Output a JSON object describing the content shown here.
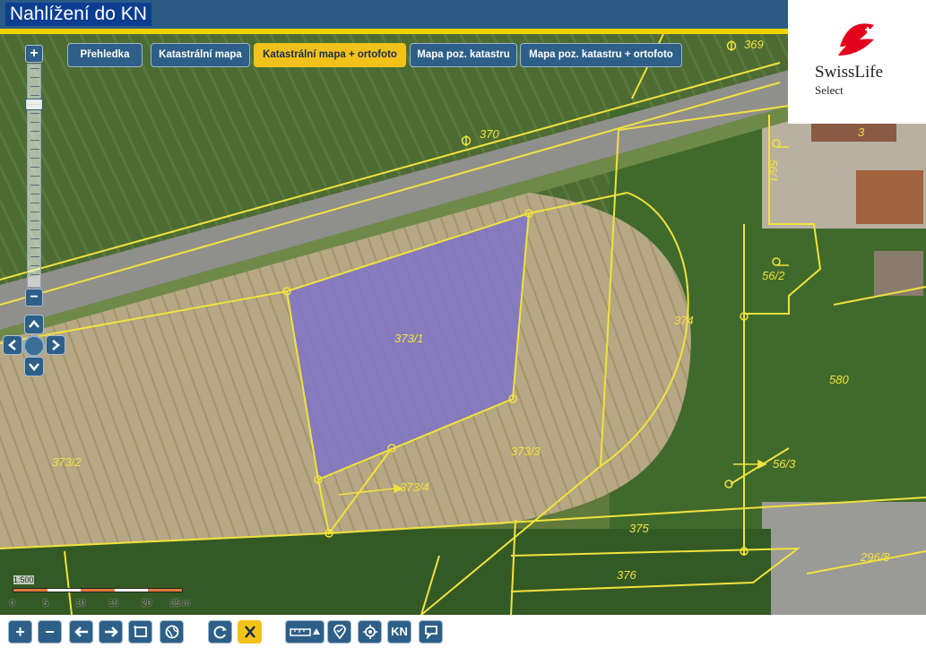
{
  "header": {
    "title": "Nahlížení do KN"
  },
  "brand": {
    "name": "SwissLife",
    "sub": "Select",
    "accent": "#e3001b"
  },
  "layer_tabs": [
    {
      "label": "Přehledka",
      "active": false
    },
    {
      "label": "Katastrální mapa",
      "active": false
    },
    {
      "label": "Katastrální mapa + ortofoto",
      "active": true
    },
    {
      "label": "Mapa poz. katastru",
      "active": false
    },
    {
      "label": "Mapa poz. katastru + ortofoto",
      "active": false
    }
  ],
  "zoom": {
    "plus_label": "+",
    "minus_label": "−"
  },
  "parcels": {
    "p369": "369",
    "p370": "370",
    "p374": "374",
    "p373_1": "373/1",
    "p373_2": "373/2",
    "p373_3": "373/3",
    "p373_4": "373/4",
    "p375": "375",
    "p376": "376",
    "p580": "580",
    "p56_1": "56/1",
    "p56_2": "56/2",
    "p56_3": "56/3",
    "p296_8": "296/8",
    "p3": "3"
  },
  "scale": {
    "ratio": "1:500",
    "labels": [
      "0",
      "5",
      "10",
      "15",
      "20",
      "25 m"
    ],
    "colors": [
      "#e07a3a",
      "#ffffff",
      "#e07a3a",
      "#ffffff",
      "#e07a3a"
    ]
  },
  "toolbar": {
    "zoom_in": "+",
    "zoom_out": "−",
    "kn_label": "KN"
  },
  "colors": {
    "parcel_line": "#f2e23c",
    "selected_parcel": "#7b72c9",
    "ui_blue": "#2d5f88",
    "ui_active": "#f2c21b"
  }
}
